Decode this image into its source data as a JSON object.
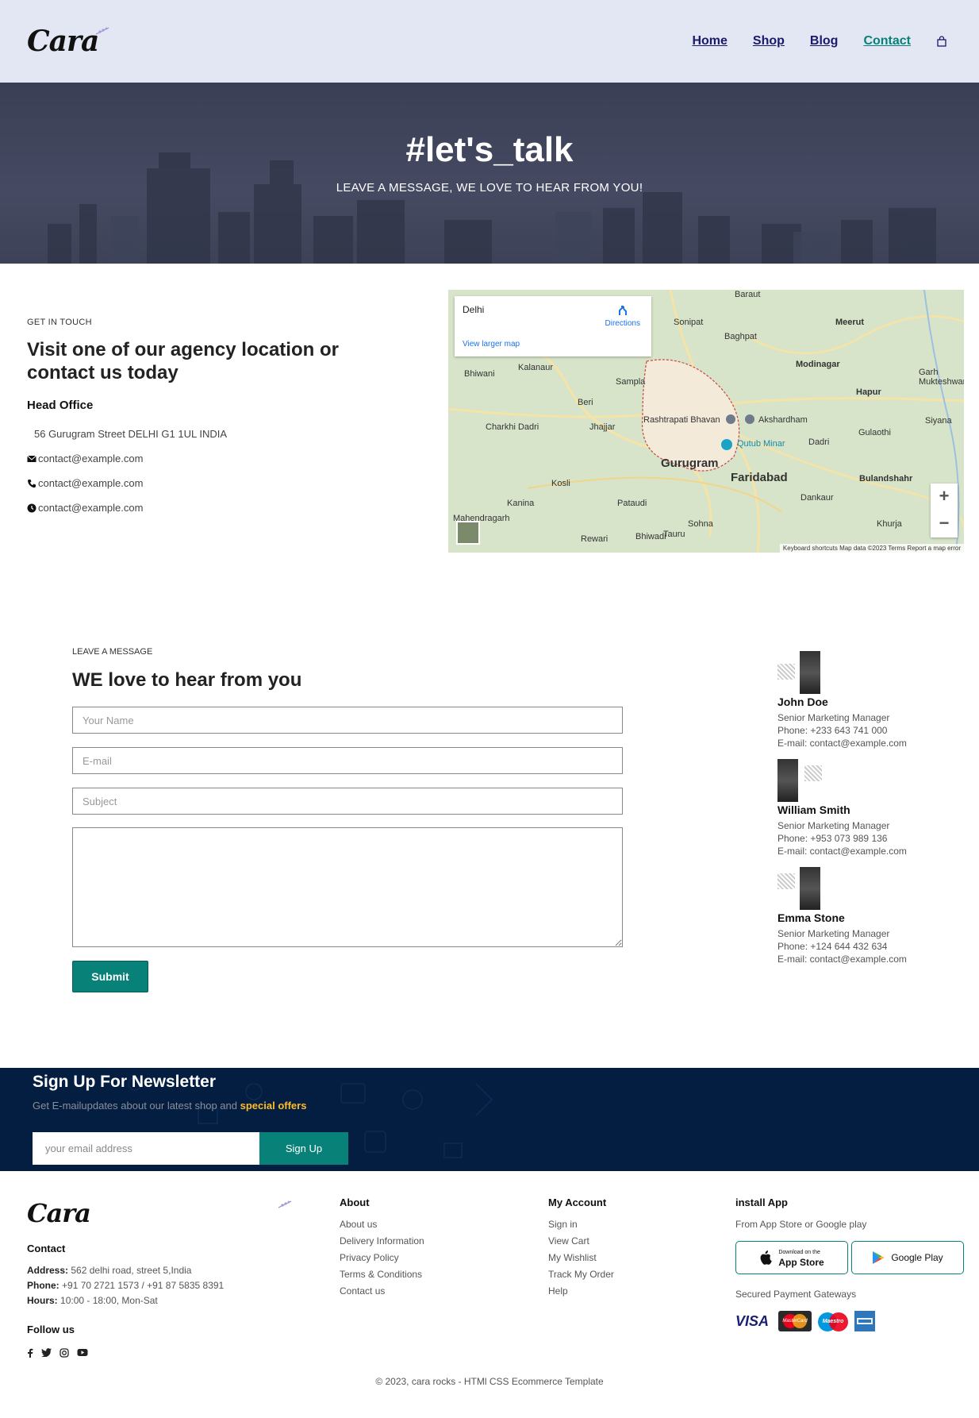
{
  "header": {
    "logo": "Cara",
    "nav": [
      {
        "label": "Home"
      },
      {
        "label": "Shop"
      },
      {
        "label": "Blog"
      },
      {
        "label": "Contact"
      }
    ]
  },
  "hero": {
    "title": "#let's_talk",
    "subtitle": "LEAVE A MESSAGE, WE LOVE TO HEAR FROM YOU!"
  },
  "details": {
    "eyebrow": "GET IN TOUCH",
    "title": "Visit one of our agency location or contact us today",
    "office_heading": "Head Office",
    "address": "56 Gurugram Street DELHI G1 1UL INDIA",
    "email_1": "contact@example.com",
    "phone_line": "contact@example.com",
    "hours_line": "contact@example.com"
  },
  "map": {
    "place": "Delhi",
    "directions": "Directions",
    "larger_map": "View larger map",
    "zoom_in": "+",
    "zoom_out": "−",
    "attribution": "Keyboard shortcuts   Map data ©2023   Terms   Report a map error",
    "labels": {
      "sonipat": "Sonipat",
      "meerut": "Meerut",
      "modinagar": "Modinagar",
      "hapur": "Hapur",
      "gurugram": "Gurugram",
      "faridabad": "Faridabad",
      "qutub": "Qutub Minar",
      "rashtrapati": "Rashtrapati Bhavan",
      "akshardham": "Akshardham",
      "bhiwani": "Bhiwani",
      "jhajjar": "Jhajjar",
      "bulandshahr": "Bulandshahr",
      "rewari": "Rewari",
      "dankaur": "Dankaur",
      "baghpat": "Baghpat",
      "kalanaur": "Kalanaur",
      "sampla": "Sampla",
      "charkhi": "Charkhi Dadri",
      "kosli": "Kosli",
      "pataudi": "Pataudi",
      "sohna": "Sohna",
      "dadri": "Dadri",
      "khurja": "Khurja",
      "siyana": "Siyana",
      "gulaothi": "Gulaothi",
      "garh": "Garh Mukteshwar",
      "baraut": "Baraut",
      "beri": "Beri",
      "kanina": "Kanina",
      "mahendragarh": "Mahendragarh",
      "bhiwadi": "Bhiwadi",
      "tauru": "Tauru"
    }
  },
  "form": {
    "eyebrow": "LEAVE A MESSAGE",
    "title": "WE love to hear from you",
    "name_placeholder": "Your Name",
    "email_placeholder": "E-mail",
    "subject_placeholder": "Subject",
    "submit": "Submit"
  },
  "people": [
    {
      "name": "John Doe",
      "role": "Senior Marketing Manager",
      "phone": "Phone: +233 643 741 000",
      "email": "E-mail: contact@example.com"
    },
    {
      "name": "William Smith",
      "role": "Senior Marketing Manager",
      "phone": "Phone: +953 073 989 136",
      "email": "E-mail: contact@example.com"
    },
    {
      "name": "Emma Stone",
      "role": "Senior Marketing Manager",
      "phone": "Phone: +124 644 432 634",
      "email": "E-mail: contact@example.com"
    }
  ],
  "newsletter": {
    "title": "Sign Up For Newsletter",
    "text_prefix": "Get E-mailupdates about our latest shop and",
    "text_highlight": "special offers",
    "placeholder": "your email address",
    "button": "Sign Up"
  },
  "footer": {
    "logo": "Cara",
    "contact_heading": "Contact",
    "address_label": "Address:",
    "address_value": "562 delhi road, street 5,India",
    "phone_label": "Phone:",
    "phone_value": "+91 70 2721 1573 / +91 87 5835 8391",
    "hours_label": "Hours:",
    "hours_value": "10:00 - 18:00, Mon-Sat",
    "follow_heading": "Follow us",
    "about_heading": "About",
    "about_links": [
      "About us",
      "Delivery Information",
      "Privacy Policy",
      "Terms & Conditions",
      "Contact us"
    ],
    "account_heading": "My Account",
    "account_links": [
      "Sign in",
      "View Cart",
      "My Wishlist",
      "Track My Order",
      "Help"
    ],
    "install_heading": "install App",
    "install_text": "From App Store or Google play",
    "appstore_small": "Download on the",
    "appstore_big": "App Store",
    "googleplay": "Google Play",
    "payments_text": "Secured Payment Gateways",
    "visa": "VISA",
    "mastercard": "MasterCard",
    "maestro": "Maestro",
    "copyright": "© 2023, cara rocks - HTMl CSS Ecommerce Template"
  },
  "colors": {
    "accent": "#088178",
    "header_bg": "#e3e6f3",
    "newsletter_bg": "#041e42",
    "highlight": "#ffbd27"
  }
}
